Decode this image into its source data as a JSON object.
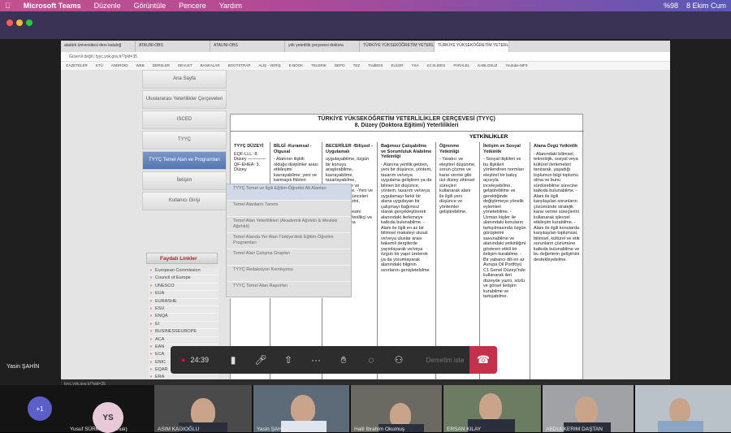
{
  "menubar": {
    "app": "Microsoft Teams",
    "items": [
      "Düzenle",
      "Görüntüle",
      "Pencere",
      "Yardım"
    ],
    "battery": "%98",
    "date": "8 Ekim Cum"
  },
  "browser": {
    "tabs": [
      "atatürk üniversitesi ders kataloğ",
      "ATAUNI-OBS",
      "ATAUNI-OBS",
      "yök yeterlilik çerçevesi doktora",
      "TÜRKİYE YÜKSEKÖĞRETİM YETERLİ",
      "TÜRKİYE YÜKSEKÖĞRETİM YETERLİ"
    ],
    "address": "Güvenli değil | tyyc.yok.gov.tr/?pid=35",
    "bookmarks": [
      "GAZETELER",
      "KTÜ",
      "ANDROID",
      "WEB",
      "DERSLER",
      "DEVLET",
      "BANKALAR",
      "BOOTSTRAP",
      "ALIŞ - VERİŞ",
      "E-BOOK",
      "TELERIK",
      "DEPO",
      "TEZ",
      "TradEDS",
      "EULER",
      "YSA",
      "K2.SLIDES",
      "PARALEL",
      "KABLOSUZ",
      "Youtube-MP3"
    ]
  },
  "sidebar": [
    "Ana Sayfa",
    "Uluslararası Yeterlilikler Çerçeveleri",
    "ISCED",
    "TYYÇ",
    "TYYÇ Temel Alan ve Programları",
    "İletişim",
    "Kullanıcı Girişi"
  ],
  "faydali": "Faydalı Linkler",
  "links": [
    "European Commission",
    "Council of Europe",
    "UNESCO",
    "EUA",
    "EURASHE",
    "ESU",
    "ENQA",
    "EI",
    "BUSINESSEUROPE",
    "ACA",
    "EAN",
    "ECA",
    "ENIC",
    "EQAR",
    "ERA",
    "EUROSTAT"
  ],
  "flyout": [
    "TYYÇ Temel ve İlgili Eğitim-Öğretim Alt Alanları",
    "Temel Alanların Tanımı",
    "Temel Alan Yeterlilikleri (Akademik Ağırlıklı & Mesleki Ağırlıklı)",
    "Temel Alanda Yer Alan Türkiye'deki Eğitim-Öğretim Programları",
    "Temel Alan Çalışma Grupları",
    "TYYÇ Redaksiyon Komisyonu",
    "TYYÇ Temel Alan Raporları"
  ],
  "doc": {
    "title": "TÜRKİYE YÜKSEKÖĞRETİM YETERLİLİKLER ÇERÇEVESİ (TYYÇ)",
    "subtitle": "8. Düzey (Doktora Eğitimi) Yeterlilikleri",
    "yet": "YETKİNLİKLER",
    "c1h": "TYYÇ DÜZEYİ",
    "c1": "EQF-LLL: 8. Düzey ———— QF-EHEA: 3. Düzey",
    "c2h": "BİLGİ -Kuramsal -Olgusal",
    "c2": "- Alanının ilişkili olduğu disiplinler arası etkileşimi kavrayabilme; yeni ve karmaşık fikirleri analiz, sentez ve değerlendirmede uzmanlık gerektiren bilgileri kullanarak özgün sonuçlara ulaşabilme.",
    "c3h": "BECERİLER -Bilişsel -Uygulamalı",
    "c3": "uygulayabilme, özgün bir konuyu araştırabilme, kavrayabilme, tasarlayabilme, uyarlayabilme ve uygulayabilme. -Yeni ve karmaşık düşünceleri eleştirel analizini, sentezini ve değerlendirmesini yapabilme. -Yenilikçi ve özgün arştırma",
    "c4h": "Bağımsız Çalışabilme ve Sorumluluk Alabilme Yetkinliği",
    "c4": "- Alanına yenilik getiren, yeni bir düşünce, yöntem, tasarım ve/veya uygulama geliştiren ya da bilinen bir düşünce, yöntem, tasarım ve/veya uygulamayı farklı bir alana uygulayan bir çalışmayı bağımsız olarak gerçekleştirerek alanındaki ilerlemeye katkıda bulunabilme. - Alanı ile ilgili en az bir bilimsel makaleyi ulusal ve/veya uluslar arası hakemli dergilerde yayınlayarak ve/veya özgün bir yapıt üreterek ya da yorumlayarak alanındaki bilginin sınırlarını genişletebilme.",
    "c5h": "Öğrenme Yetkinliği",
    "c5": "- Yaratıcı ve eleştirel düşünme, sorun çözme ve karar verme gibi üst düzey zihinsel süreçleri kullanarak alanı ile ilgili yeni düşünce ve yöntemler geliştirebilme.",
    "c6h": "İletişim ve Sosyal Yetkinlik",
    "c6": "- Sosyal ilişkileri ve bu ilişkileri yönlendiren normları eleştirel bir bakış açısıyla inceleyebilme, geliştirebilme ve gerektiğinde değiştirmeye yönelik eylemleri yönetebilme. - Uzman kişiler ile alanındaki konuların tartışılmasında özgün görüşlerini savunabilme ve alanındaki yetkinliğini gösteren etkili bir iletişim kurabilme. - Bir yabancı dili en az Avrupa Dil Portföyü C1 Genel Düzeyi'nde kullanarak ileri düzeyde yazılı, sözlü ve görsel iletişim kurabilme ve tartışabilme.",
    "c7h": "Alana Özgü Yetkinlik",
    "c7": "- Alanındaki bilimsel, teknolojik, sosyal veya kültürel ilerlemeleri tanıtarak, yaşadığı toplumun bilgi toplumu olma ve bunu sürdürebilme sürecine katkıda bulunabilme. - Alanı ile ilgili karşılaşılan sorunların çözümünde stratejik karar verme süreçlerini kullanarak işlevsel etkileşim kurabilme. - Alanı ile ilgili konularda karşılaşılan toplumsal, bilimsel, kültürel ve etik sorunların çözümüne katkıda bulunabilme ve bu değerlerin gelişimini destekleyebilme."
  },
  "call": {
    "timer": "24:39",
    "stop": "Demetim iste"
  },
  "status_url": "tyyc.yok.gov.tr/?pid=35",
  "presenter": "Yasin ŞAHİN",
  "participants": {
    "more": "+1",
    "initials": "YS",
    "names": [
      "Yusuf SÜRMEN (Konuk)",
      "ASIM KADIOĞLU",
      "Yasin ŞAHİN",
      "Halil İbrahim Okumuş",
      "ERSAN KILAY",
      "ABDULKERIM DAŞTAN",
      ""
    ]
  }
}
